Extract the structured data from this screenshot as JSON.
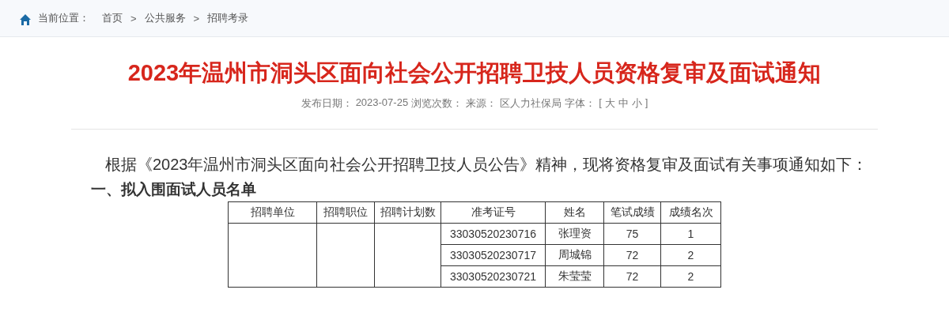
{
  "breadcrumb": {
    "label": "当前位置：",
    "items": [
      {
        "text": "首页"
      },
      {
        "text": "公共服务"
      },
      {
        "text": "招聘考录"
      }
    ],
    "separator": ">"
  },
  "article": {
    "title": "2023年温州市洞头区面向社会公开招聘卫技人员资格复审及面试通知",
    "meta": {
      "date_label": "发布日期：",
      "date": "2023-07-25",
      "views_label": "浏览次数：",
      "source_label": "来源：",
      "source": "区人力社保局",
      "font_label": "字体：",
      "bracket_open": "[",
      "font_sizes": [
        "大",
        "中",
        "小"
      ],
      "bracket_close": "]"
    },
    "paragraph": "根据《2023年温州市洞头区面向社会公开招聘卫技人员公告》精神，现将资格复审及面试有关事项通知如下：",
    "section_heading": "一、拟入围面试人员名单",
    "table": {
      "columns": [
        "招聘单位",
        "招聘职位",
        "招聘计划数",
        "准考证号",
        "姓名",
        "笔试成绩",
        "成绩名次"
      ],
      "rows": [
        {
          "exam_no": "33030520230716",
          "name": "张理资",
          "score": "75",
          "rank": "1"
        },
        {
          "exam_no": "33030520230717",
          "name": "周城锦",
          "score": "72",
          "rank": "2"
        },
        {
          "exam_no": "33030520230721",
          "name": "朱莹莹",
          "score": "72",
          "rank": "2"
        }
      ]
    }
  }
}
